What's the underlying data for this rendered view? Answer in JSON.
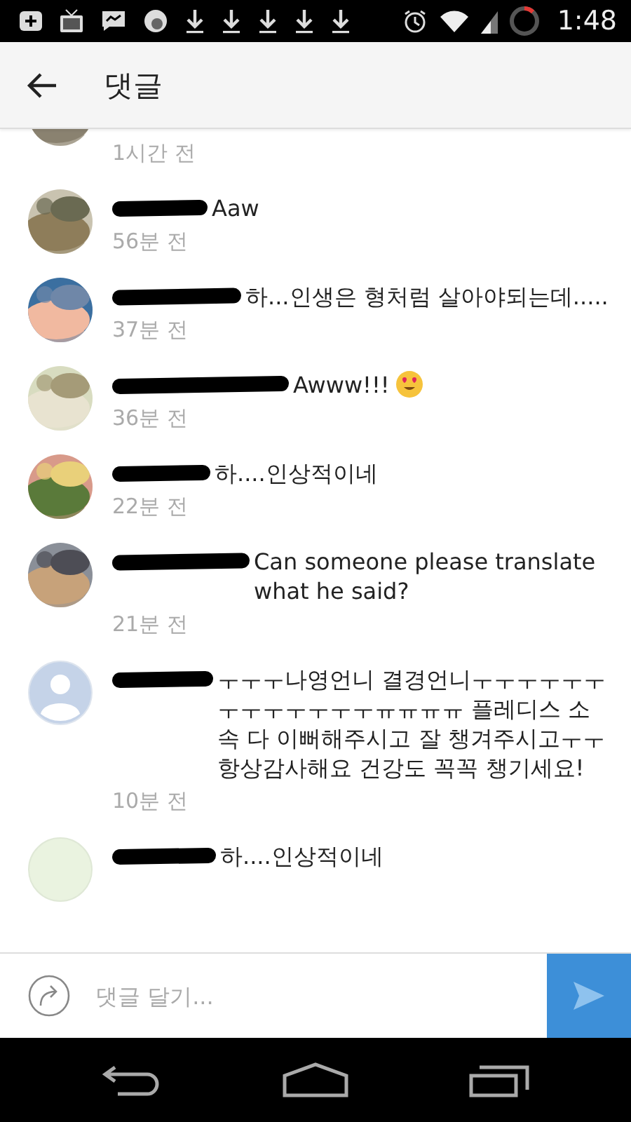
{
  "status_bar": {
    "time": "1:48"
  },
  "app_bar": {
    "title": "댓글"
  },
  "comments": [
    {
      "kind": "cut",
      "time": "1시간 전"
    },
    {
      "kind": "full",
      "name_redacted": true,
      "text": "Aaw",
      "time": "56분 전"
    },
    {
      "kind": "full",
      "name_redacted": true,
      "text": "하...인생은 형처럼 살아야되는데.....",
      "time": "37분 전"
    },
    {
      "kind": "full",
      "name_redacted": true,
      "text": "Awww!!!",
      "time": "36분 전",
      "emoji": true
    },
    {
      "kind": "full",
      "name_redacted": true,
      "text": "하....인상적이네",
      "time": "22분 전"
    },
    {
      "kind": "full",
      "name_redacted": true,
      "text": "Can someone please translate what he said?",
      "time": "21분 전"
    },
    {
      "kind": "full",
      "avatar": {
        "kind": "default"
      },
      "name_redacted": true,
      "text": "ㅜㅜㅜ나영언니 결경언니ㅜㅜㅜㅜㅜㅜㅜㅜㅜㅜㅜㅜㅜㅠㅠㅠㅠ 플레디스 소속 다 이뻐해주시고 잘 챙겨주시고ㅜㅜ 항상감사해요 건강도 꼭꼭 챙기세요!",
      "time": "10분 전"
    },
    {
      "kind": "full",
      "avatar": {
        "kind": "blank"
      },
      "name_redacted": true,
      "text": "하....인상적이네"
    }
  ],
  "comment_bar": {
    "placeholder": "댓글 달기..."
  }
}
